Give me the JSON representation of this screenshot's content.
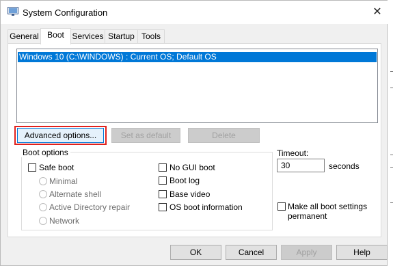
{
  "window": {
    "title": "System Configuration",
    "close_glyph": "✕",
    "icon": "system-config-icon"
  },
  "tabs": [
    "General",
    "Boot",
    "Services",
    "Startup",
    "Tools"
  ],
  "active_tab": "Boot",
  "os_list": {
    "items": [
      "Windows 10 (C:\\WINDOWS) : Current OS; Default OS"
    ],
    "selected_index": 0
  },
  "buttons": {
    "advanced": "Advanced options...",
    "set_default": "Set as default",
    "delete": "Delete"
  },
  "boot_options": {
    "label": "Boot options",
    "safe_boot": "Safe boot",
    "minimal": "Minimal",
    "alternate_shell": "Alternate shell",
    "active_directory_repair": "Active Directory repair",
    "network": "Network",
    "no_gui_boot": "No GUI boot",
    "boot_log": "Boot log",
    "base_video": "Base video",
    "os_boot_information": "OS boot information"
  },
  "timeout": {
    "label": "Timeout:",
    "value": "30",
    "unit": "seconds"
  },
  "make_permanent": {
    "line1": "Make all boot settings",
    "line2": "permanent"
  },
  "footer": {
    "ok": "OK",
    "cancel": "Cancel",
    "apply": "Apply",
    "help": "Help"
  },
  "colors": {
    "selection": "#0078d7",
    "highlight_border": "#e0211d"
  }
}
